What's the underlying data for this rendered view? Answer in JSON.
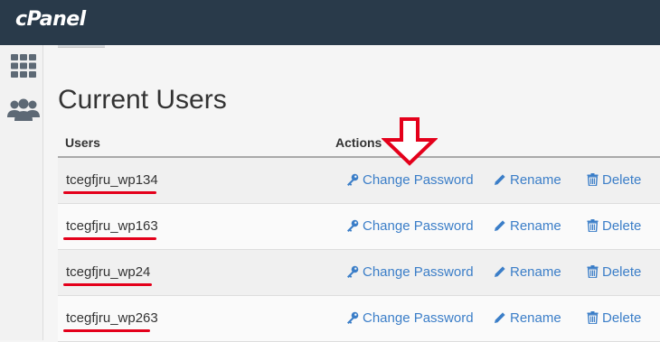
{
  "app": {
    "logo": "cPanel"
  },
  "sidebar": {
    "items": [
      {
        "icon": "grid-icon"
      },
      {
        "icon": "users-icon"
      }
    ]
  },
  "page": {
    "title": "Current Users",
    "columns": {
      "users": "Users",
      "actions": "Actions"
    }
  },
  "actions": {
    "change_password": "Change Password",
    "rename": "Rename",
    "delete": "Delete"
  },
  "users": [
    {
      "name": "tcegfjru_wp134"
    },
    {
      "name": "tcegfjru_wp163"
    },
    {
      "name": "tcegfjru_wp24"
    },
    {
      "name": "tcegfjru_wp263"
    }
  ],
  "colors": {
    "header_bg": "#293a4a",
    "link": "#3b7ec8",
    "annotation_red": "#e4001b"
  }
}
